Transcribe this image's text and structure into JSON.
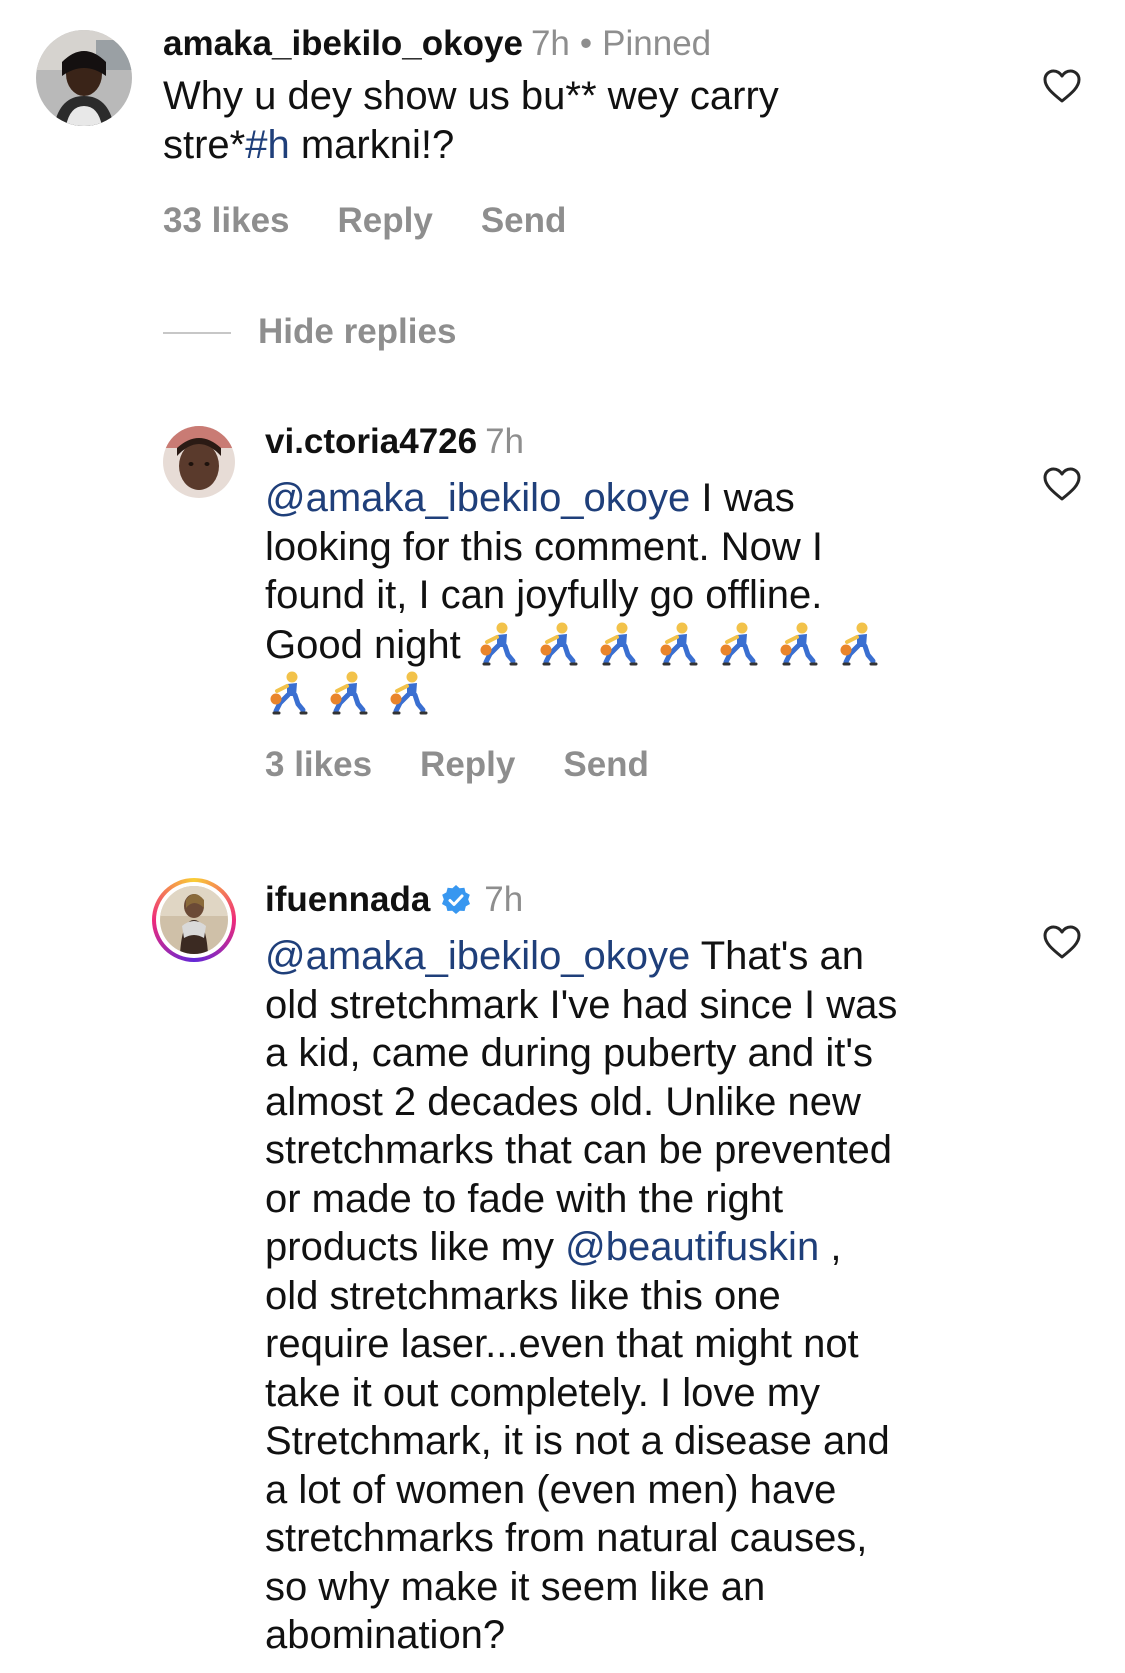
{
  "comments": [
    {
      "username": "amaka_ibekilo_okoye",
      "time": "7h",
      "pinned_label": "Pinned",
      "text_line1": "Why u dey show us bu** wey carry",
      "text_line2_pre": "stre*",
      "text_line2_hashtag": "#h",
      "text_line2_post": " markni!?",
      "likes": "33 likes",
      "reply": "Reply",
      "send": "Send"
    }
  ],
  "hide_replies": "Hide replies",
  "replies": [
    {
      "username": "vi.ctoria4726",
      "time": "7h",
      "mention": "@amaka_ibekilo_okoye",
      "line1_post": " I was",
      "line2": "looking for this comment. Now I",
      "line3": "found it, I can joyfully go offline.",
      "line4": "Good night",
      "emoji_name": "person-bouncing-ball-emoji",
      "likes": "3 likes",
      "reply": "Reply",
      "send": "Send"
    },
    {
      "username": "ifuennada",
      "verified": true,
      "time": "7h",
      "mention": "@amaka_ibekilo_okoye",
      "mention2": "@beautifuskin",
      "lines": [
        " That's an",
        "old stretchmark I've had since I was",
        "a kid, came during puberty and it's",
        "almost 2 decades old. Unlike new",
        "stretchmarks that can be prevented",
        "or made to fade with the right",
        "products like my ",
        " ,",
        "old stretchmarks like this one",
        "require laser...even that might not",
        "take it out completely. I love my",
        "Stretchmark, it is not a disease and",
        "a lot of women (even men) have",
        "stretchmarks from natural causes,",
        "so why make it seem like an",
        "abomination?"
      ]
    }
  ],
  "colors": {
    "text": "#111111",
    "muted": "#8e8e8e",
    "mention": "#1f3f7a",
    "verified": "#3897f0"
  }
}
